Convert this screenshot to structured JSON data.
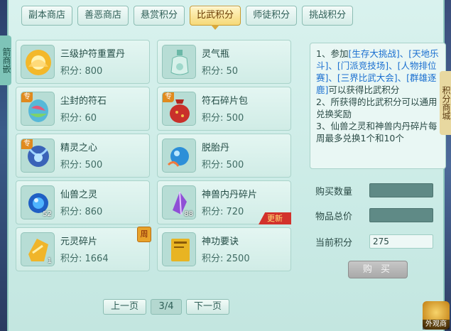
{
  "tabs": [
    {
      "label": "副本商店"
    },
    {
      "label": "善恶商店"
    },
    {
      "label": "悬赏积分"
    },
    {
      "label": "比武积分",
      "active": true
    },
    {
      "label": "师徒积分"
    },
    {
      "label": "挑战积分"
    }
  ],
  "side": {
    "left_text": "箭商嵌",
    "right_text": "积分商城"
  },
  "items": [
    {
      "name": "三级护符重置丹",
      "price": "积分: 800",
      "icon": "lotus-pill-icon"
    },
    {
      "name": "灵气瓶",
      "price": "积分: 50",
      "icon": "vase-icon"
    },
    {
      "name": "尘封的符石",
      "price": "积分: 60",
      "icon": "gem-egg-icon",
      "badge": "专"
    },
    {
      "name": "符石碎片包",
      "price": "积分: 500",
      "icon": "red-bag-icon",
      "badge": "专"
    },
    {
      "name": "精灵之心",
      "price": "积分: 500",
      "icon": "spirit-heart-icon",
      "badge": "专"
    },
    {
      "name": "脱胎丹",
      "price": "积分: 500",
      "icon": "blue-orb-icon"
    },
    {
      "name": "仙兽之灵",
      "price": "积分: 860",
      "icon": "orb-icon",
      "count": "52"
    },
    {
      "name": "神兽内丹碎片",
      "price": "积分: 720",
      "icon": "crystal-icon",
      "count": "88",
      "ribbon": "更新"
    },
    {
      "name": "元灵碎片",
      "price": "积分: 1664",
      "icon": "gold-shard-icon",
      "count": "1",
      "week": "周"
    },
    {
      "name": "神功要诀",
      "price": "积分: 2500",
      "icon": "book-icon"
    }
  ],
  "pager": {
    "prev": "上一页",
    "page": "3/4",
    "next": "下一页"
  },
  "rules": {
    "p1_a": "1、参加",
    "p1_b": "[生存大挑战]、[天地乐斗]、[门派竞技场]、[人物排位赛]、[三界比武大会]、[群雄逐鹿]",
    "p1_c": "可以获得比武积分",
    "p2": "2、所获得的比武积分可以通用兑换奖励",
    "p3": "3、仙兽之灵和神兽内丹碎片每周最多兑换1个和10个"
  },
  "form": {
    "qty_label": "购买数量",
    "qty_value": "",
    "total_label": "物品总价",
    "total_value": "",
    "points_label": "当前积分",
    "points_value": "275"
  },
  "buy_button": "购 买",
  "corner": {
    "label": "外观商"
  }
}
